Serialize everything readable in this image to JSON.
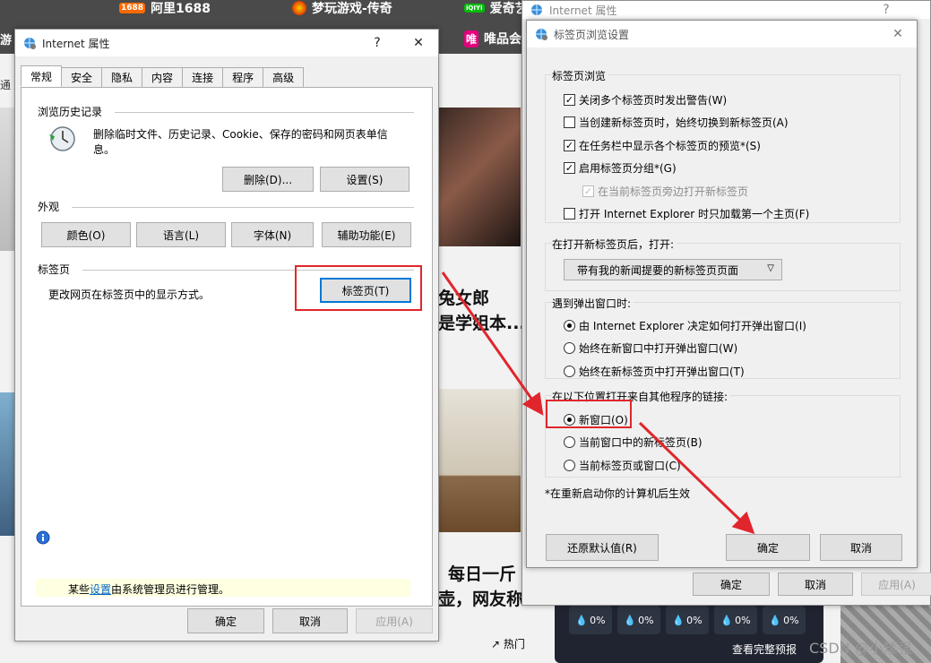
{
  "background": {
    "top_links": [
      {
        "badge": "1688",
        "label": "阿里1688"
      },
      {
        "badge": "",
        "label": "梦玩游戏-传奇"
      },
      {
        "badge": "iQIYI",
        "label": "爱奇艺"
      },
      {
        "badge": "",
        "label": "游"
      },
      {
        "badge": "唯",
        "label": "唯品会"
      }
    ],
    "left_nav": "通",
    "headline_1": "兔女郎",
    "headline_2": "是学姐本...",
    "headline_3": "每日一斤",
    "headline_4": "壶，网友称",
    "hot_label": "热门",
    "weather": {
      "cells": [
        "0%",
        "0%",
        "0%",
        "0%",
        "0%"
      ],
      "link": "查看完整预报"
    },
    "watermark": "CSDN @小矮强"
  },
  "internet_options": {
    "title": "Internet 属性",
    "help": "?",
    "close": "✕",
    "tabs": [
      "常规",
      "安全",
      "隐私",
      "内容",
      "连接",
      "程序",
      "高级"
    ],
    "history": {
      "heading": "浏览历史记录",
      "desc": "删除临时文件、历史记录、Cookie、保存的密码和网页表单信息。",
      "delete_btn": "删除(D)...",
      "settings_btn": "设置(S)"
    },
    "appearance": {
      "heading": "外观",
      "buttons": [
        "颜色(O)",
        "语言(L)",
        "字体(N)",
        "辅助功能(E)"
      ]
    },
    "tabs_section": {
      "heading": "标签页",
      "desc": "更改网页在标签页中的显示方式。",
      "button": "标签页(T)"
    },
    "admin_note": {
      "pre": "某些",
      "link": "设置",
      "post": "由系统管理员进行管理。"
    },
    "ok": "确定",
    "cancel": "取消",
    "apply": "应用(A)"
  },
  "back_window": {
    "title": "Internet 属性",
    "help": "?",
    "ok": "确定",
    "cancel": "取消",
    "apply": "应用(A)"
  },
  "tab_settings": {
    "title": "标签页浏览设置",
    "close": "✕",
    "tab_browsing": {
      "label": "标签页浏览",
      "options": [
        {
          "label": "关闭多个标签页时发出警告(W)",
          "checked": true,
          "disabled": false
        },
        {
          "label": "当创建新标签页时，始终切换到新标签页(A)",
          "checked": false,
          "disabled": false
        },
        {
          "label": "在任务栏中显示各个标签页的预览*(S)",
          "checked": true,
          "disabled": false
        },
        {
          "label": "启用标签页分组*(G)",
          "checked": true,
          "disabled": false
        },
        {
          "label": "在当前标签页旁边打开新标签页",
          "checked": true,
          "disabled": true
        },
        {
          "label": "打开 Internet Explorer 时只加载第一个主页(F)",
          "checked": false,
          "disabled": false
        }
      ]
    },
    "new_tab": {
      "label": "在打开新标签页后，打开:",
      "selected": "带有我的新闻提要的新标签页页面"
    },
    "popups": {
      "label": "遇到弹出窗口时:",
      "options": [
        {
          "label": "由 Internet Explorer 决定如何打开弹出窗口(I)",
          "selected": true
        },
        {
          "label": "始终在新窗口中打开弹出窗口(W)",
          "selected": false
        },
        {
          "label": "始终在新标签页中打开弹出窗口(T)",
          "selected": false
        }
      ]
    },
    "links": {
      "label": "在以下位置打开来自其他程序的链接:",
      "options": [
        {
          "label": "新窗口(O)",
          "selected": true
        },
        {
          "label": "当前窗口中的新标签页(B)",
          "selected": false
        },
        {
          "label": "当前标签页或窗口(C)",
          "selected": false
        }
      ]
    },
    "note": "*在重新启动你的计算机后生效",
    "restore": "还原默认值(R)",
    "ok": "确定",
    "cancel": "取消"
  },
  "colors": {
    "accent": "#0078d7",
    "highlight": "#e0262c",
    "link": "#0066cc",
    "note_bg": "#ffffe1"
  }
}
